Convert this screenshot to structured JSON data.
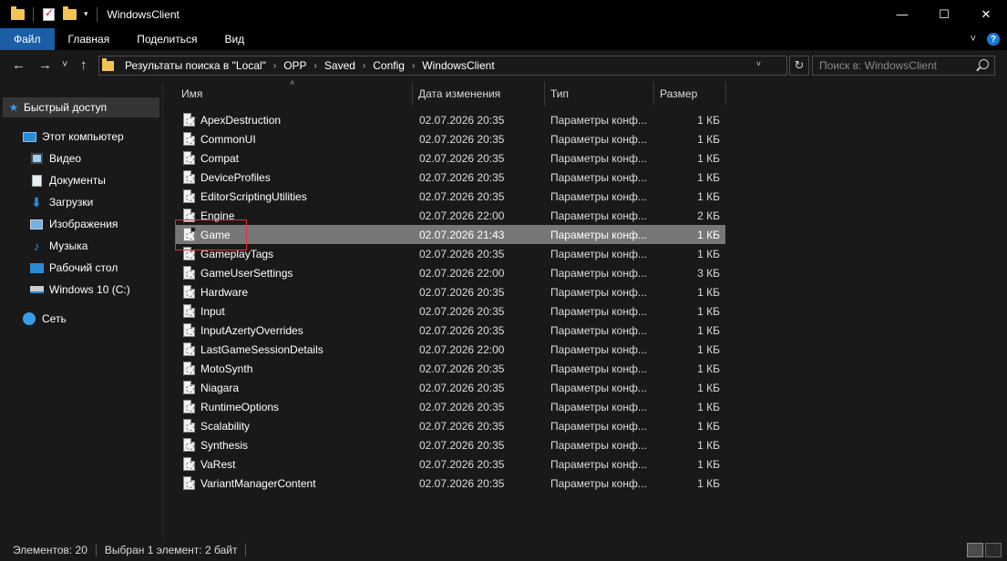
{
  "window": {
    "title": "WindowsClient",
    "minimize": "—",
    "maximize": "☐",
    "close": "✕"
  },
  "ribbon": {
    "tabs": [
      "Файл",
      "Главная",
      "Поделиться",
      "Вид"
    ],
    "collapse_icon": "˅",
    "help_icon": "?"
  },
  "nav": {
    "back": "←",
    "forward": "→",
    "recent": "˅",
    "up": "↑"
  },
  "address": {
    "crumbs": [
      "Результаты поиска в \"Local\"",
      "OPP",
      "Saved",
      "Config",
      "WindowsClient"
    ],
    "dropdown": "˅",
    "refresh": "↻"
  },
  "search": {
    "placeholder": "Поиск в: WindowsClient"
  },
  "sidebar": {
    "quick_access": "Быстрый доступ",
    "this_pc": "Этот компьютер",
    "items": [
      "Видео",
      "Документы",
      "Загрузки",
      "Изображения",
      "Музыка",
      "Рабочий стол",
      "Windows 10 (C:)"
    ],
    "network": "Сеть"
  },
  "columns": {
    "name": "Имя",
    "date": "Дата изменения",
    "type": "Тип",
    "size": "Размер",
    "sort_indicator": "˄"
  },
  "files": [
    {
      "name": "ApexDestruction",
      "date": "02.07.2026 20:35",
      "type": "Параметры конф...",
      "size": "1 КБ"
    },
    {
      "name": "CommonUI",
      "date": "02.07.2026 20:35",
      "type": "Параметры конф...",
      "size": "1 КБ"
    },
    {
      "name": "Compat",
      "date": "02.07.2026 20:35",
      "type": "Параметры конф...",
      "size": "1 КБ"
    },
    {
      "name": "DeviceProfiles",
      "date": "02.07.2026 20:35",
      "type": "Параметры конф...",
      "size": "1 КБ"
    },
    {
      "name": "EditorScriptingUtilities",
      "date": "02.07.2026 20:35",
      "type": "Параметры конф...",
      "size": "1 КБ"
    },
    {
      "name": "Engine",
      "date": "02.07.2026 22:00",
      "type": "Параметры конф...",
      "size": "2 КБ"
    },
    {
      "name": "Game",
      "date": "02.07.2026 21:43",
      "type": "Параметры конф...",
      "size": "1 КБ"
    },
    {
      "name": "GameplayTags",
      "date": "02.07.2026 20:35",
      "type": "Параметры конф...",
      "size": "1 КБ"
    },
    {
      "name": "GameUserSettings",
      "date": "02.07.2026 22:00",
      "type": "Параметры конф...",
      "size": "3 КБ"
    },
    {
      "name": "Hardware",
      "date": "02.07.2026 20:35",
      "type": "Параметры конф...",
      "size": "1 КБ"
    },
    {
      "name": "Input",
      "date": "02.07.2026 20:35",
      "type": "Параметры конф...",
      "size": "1 КБ"
    },
    {
      "name": "InputAzertyOverrides",
      "date": "02.07.2026 20:35",
      "type": "Параметры конф...",
      "size": "1 КБ"
    },
    {
      "name": "LastGameSessionDetails",
      "date": "02.07.2026 22:00",
      "type": "Параметры конф...",
      "size": "1 КБ"
    },
    {
      "name": "MotoSynth",
      "date": "02.07.2026 20:35",
      "type": "Параметры конф...",
      "size": "1 КБ"
    },
    {
      "name": "Niagara",
      "date": "02.07.2026 20:35",
      "type": "Параметры конф...",
      "size": "1 КБ"
    },
    {
      "name": "RuntimeOptions",
      "date": "02.07.2026 20:35",
      "type": "Параметры конф...",
      "size": "1 КБ"
    },
    {
      "name": "Scalability",
      "date": "02.07.2026 20:35",
      "type": "Параметры конф...",
      "size": "1 КБ"
    },
    {
      "name": "Synthesis",
      "date": "02.07.2026 20:35",
      "type": "Параметры конф...",
      "size": "1 КБ"
    },
    {
      "name": "VaRest",
      "date": "02.07.2026 20:35",
      "type": "Параметры конф...",
      "size": "1 КБ"
    },
    {
      "name": "VariantManagerContent",
      "date": "02.07.2026 20:35",
      "type": "Параметры конф...",
      "size": "1 КБ"
    }
  ],
  "selected_file": "Game",
  "status": {
    "count": "Элементов: 20",
    "selection": "Выбран 1 элемент: 2 байт"
  },
  "colors": {
    "file_tab": "#1a5ea8",
    "selected_row": "#777777",
    "highlight_box": "#e03030",
    "background": "#191919"
  }
}
